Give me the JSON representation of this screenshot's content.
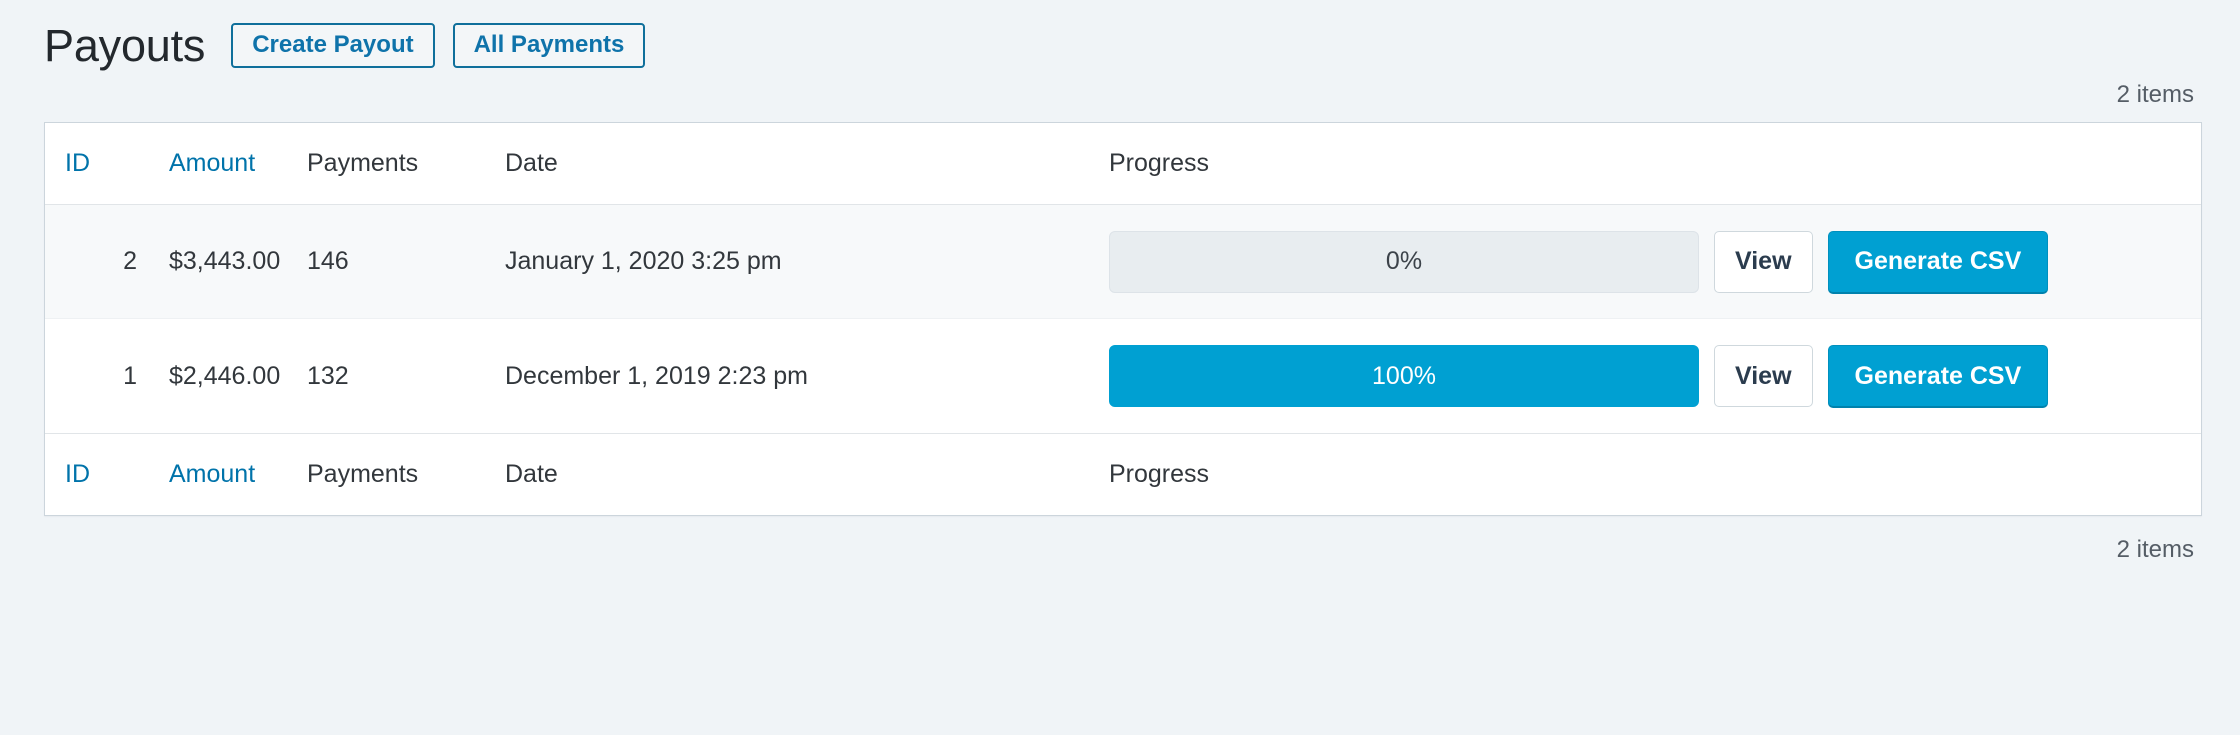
{
  "header": {
    "title": "Payouts",
    "actions": [
      {
        "label": "Create Payout",
        "name": "create-payout-button"
      },
      {
        "label": "All Payments",
        "name": "all-payments-button"
      }
    ]
  },
  "tablenav": {
    "top_count": "2 items",
    "bottom_count": "2 items"
  },
  "table": {
    "columns": [
      {
        "key": "id",
        "label": "ID",
        "sortable": true
      },
      {
        "key": "amount",
        "label": "Amount",
        "sortable": true
      },
      {
        "key": "payments",
        "label": "Payments",
        "sortable": false
      },
      {
        "key": "date",
        "label": "Date",
        "sortable": false
      },
      {
        "key": "progress",
        "label": "Progress",
        "sortable": false
      }
    ],
    "rows": [
      {
        "id": "2",
        "amount": "$3,443.00",
        "payments": "146",
        "date": "January 1, 2020 3:25 pm",
        "progress_label": "0%",
        "progress_percent": 0,
        "view_label": "View",
        "generate_label": "Generate CSV"
      },
      {
        "id": "1",
        "amount": "$2,446.00",
        "payments": "132",
        "date": "December 1, 2019 2:23 pm",
        "progress_label": "100%",
        "progress_percent": 100,
        "view_label": "View",
        "generate_label": "Generate CSV"
      }
    ]
  },
  "colors": {
    "accent_blue": "#0073aa",
    "progress_fill": "#00a0d2",
    "progress_track": "#e8edf0",
    "page_background": "#f0f4f7",
    "button_border": "#0f6f9b"
  }
}
